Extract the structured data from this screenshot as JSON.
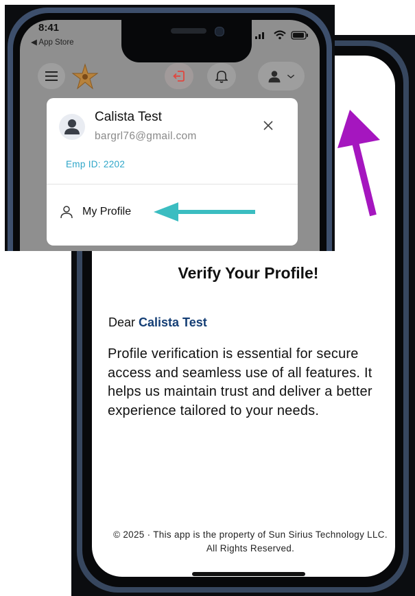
{
  "status_bar": {
    "time": "8:41",
    "back_app": "◀ App Store"
  },
  "header": {
    "menu_icon": "hamburger-icon",
    "logo_icon": "star-logo",
    "logout_icon": "logout-icon",
    "notification_icon": "bell-icon",
    "profile_icon": "user-icon",
    "chevron_icon": "chevron-down-icon"
  },
  "profile_dropdown": {
    "name": "Calista Test",
    "email": "bargrl76@gmail.com",
    "emp_id": "Emp ID: 2202",
    "menu_item": "My Profile"
  },
  "verify_screen": {
    "title": "Verify Your Profile!",
    "greeting": "Dear",
    "user_name": "Calista Test",
    "body": "Profile verification is essential for secure access and seamless use of all features. It helps us maintain trust and deliver a better experience tailored to your needs.",
    "footer": "© 2025 · This app is the property of Sun Sirius Technology LLC. All Rights Reserved."
  },
  "colors": {
    "name_accent": "#143e75",
    "emp_id": "#2ea6c8",
    "teal_arrow": "#3bbdc1",
    "purple_arrow": "#a516bf",
    "logout_accent": "#e0473f"
  }
}
